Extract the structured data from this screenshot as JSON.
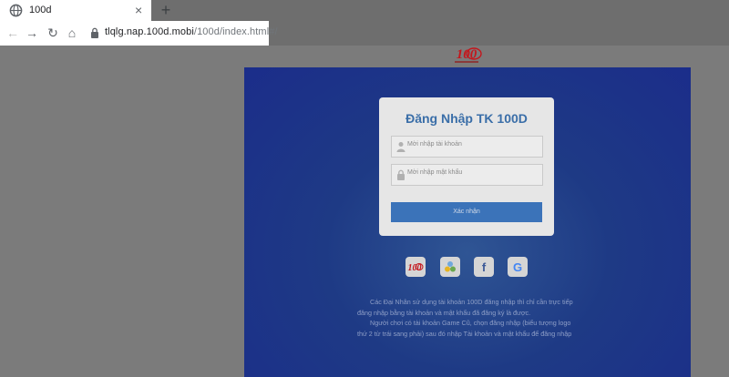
{
  "browser": {
    "tab_title": "100d",
    "new_tab_symbol": "+",
    "close_symbol": "×",
    "url_host": "tlqlg.nap.100d.mobi",
    "url_path": "/100d/index.html#/",
    "icons": [
      "globe-icon",
      "back-icon",
      "forward-icon",
      "reload-icon",
      "home-icon",
      "lock-icon"
    ]
  },
  "brand": {
    "logo_text": "100",
    "accent_color": "#c4161c"
  },
  "login": {
    "title": "Đăng Nhập TK 100D",
    "username_placeholder": "Mời nhập tài khoản",
    "password_placeholder": "Mời nhập mật khẩu",
    "submit_label": "Xác nhận"
  },
  "social": {
    "items": [
      "100d-logo-icon",
      "app-icon",
      "facebook-icon",
      "google-icon"
    ],
    "facebook_label": "f",
    "google_label": "G"
  },
  "description": {
    "paragraph1": "Các Đại Nhân sử dụng tài khoản 100D đăng nhập thì chỉ cần trực tiếp đăng nhập bằng tài khoản và mật khẩu đã đăng ký là được.",
    "paragraph2": "Người chơi có tài khoản Game Cũ, chọn đăng nhập (biểu tượng logo thứ 2 từ trái sang phải) sau đó nhập Tài khoản và mật khẩu để đăng nhập"
  },
  "colors": {
    "panel_blue": "#1e3a85",
    "title_blue": "#3a6ea8",
    "button_blue": "#3b73b9",
    "overlay_gray": "#7b7b7b"
  }
}
